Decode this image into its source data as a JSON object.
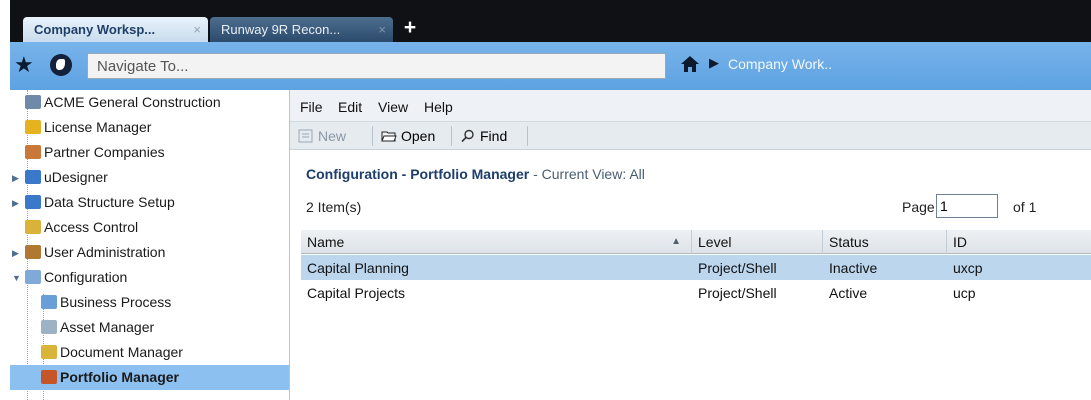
{
  "tabs": [
    {
      "label": "Company Worksp...",
      "close": "×",
      "active": true
    },
    {
      "label": "Runway 9R Recon...",
      "close": "×",
      "active": false
    }
  ],
  "new_tab_icon": "+",
  "nav": {
    "star_icon": "★",
    "input_placeholder": "Navigate To...",
    "breadcrumb_arrow": "▶",
    "breadcrumb": "Company Work.."
  },
  "tree": [
    {
      "label": "ACME General Construction",
      "icon": "building-icon",
      "color": "#6f8aa8",
      "level": 1,
      "expand": ""
    },
    {
      "label": "License Manager",
      "icon": "license-icon",
      "color": "#e6b21f",
      "level": 1,
      "expand": ""
    },
    {
      "label": "Partner Companies",
      "icon": "partner-icon",
      "color": "#c9783a",
      "level": 1,
      "expand": ""
    },
    {
      "label": "uDesigner",
      "icon": "udesigner-icon",
      "color": "#3a78c9",
      "level": 1,
      "expand": "▶"
    },
    {
      "label": "Data Structure Setup",
      "icon": "data-structure-icon",
      "color": "#3a78c9",
      "level": 1,
      "expand": "▶"
    },
    {
      "label": "Access Control",
      "icon": "key-icon",
      "color": "#d9b23a",
      "level": 1,
      "expand": ""
    },
    {
      "label": "User Administration",
      "icon": "users-icon",
      "color": "#b07830",
      "level": 1,
      "expand": "▶"
    },
    {
      "label": "Configuration",
      "icon": "configuration-icon",
      "color": "#7fa9d6",
      "level": 1,
      "expand": "▼"
    },
    {
      "label": "Business Process",
      "icon": "business-process-icon",
      "color": "#6a9ed8",
      "level": 2,
      "expand": ""
    },
    {
      "label": "Asset Manager",
      "icon": "asset-manager-icon",
      "color": "#9eb2c6",
      "level": 2,
      "expand": ""
    },
    {
      "label": "Document Manager",
      "icon": "document-manager-icon",
      "color": "#d8b43a",
      "level": 2,
      "expand": ""
    },
    {
      "label": "Portfolio Manager",
      "icon": "briefcase-icon",
      "color": "#c4562a",
      "level": 2,
      "expand": "",
      "selected": true
    }
  ],
  "menu": [
    "File",
    "Edit",
    "View",
    "Help"
  ],
  "toolbar": {
    "new_label": "New",
    "open_label": "Open",
    "find_label": "Find"
  },
  "view": {
    "title": "Configuration - Portfolio Manager",
    "subtitle": "- Current View:  All",
    "items_count": "2  Item(s)",
    "page_label": "Page",
    "page_value": "1",
    "page_of": "of  1"
  },
  "grid": {
    "columns": [
      "Name",
      "Level",
      "Status",
      "ID"
    ],
    "sort_icon": "▲",
    "rows": [
      {
        "name": "Capital Planning",
        "level": "Project/Shell",
        "status": "Inactive",
        "id": "uxcp",
        "selected": true
      },
      {
        "name": "Capital Projects",
        "level": "Project/Shell",
        "status": "Active",
        "id": "ucp",
        "selected": false
      }
    ]
  },
  "colors": {
    "tabbar_bg": "#0f1114",
    "navbar_bg": "#6aaae6",
    "selected_tree_row": "#8cc0f0",
    "selected_grid_row": "#bcd6ee",
    "title_text": "#1d3d6a"
  }
}
